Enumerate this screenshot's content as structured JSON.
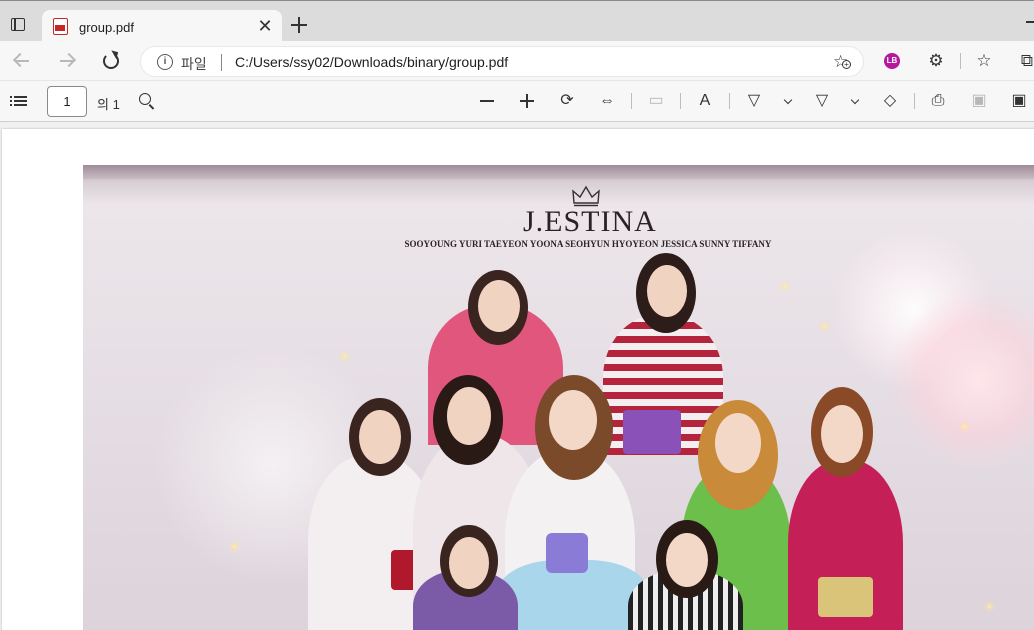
{
  "browser": {
    "tab_title": "group.pdf",
    "tab_close_glyph": "✕",
    "scheme_label": "파일",
    "url": "C:/Users/ssy02/Downloads/binary/group.pdf",
    "profile_initials": "LB"
  },
  "pdf_toolbar": {
    "current_page": "1",
    "page_total": "의 1"
  },
  "document": {
    "brand": "J.ESTINA",
    "member_names": "SOOYOUNG YURI TAEYEON YOONA SEOHYUN HYOYEON JESSICA SUNNY TIFFANY"
  },
  "icons": [
    "window-icon",
    "pdf-file-icon",
    "close-icon",
    "new-tab-icon",
    "back-icon",
    "forward-icon",
    "reload-icon",
    "info-icon",
    "favorite-add-icon",
    "profile-icon",
    "extensions-icon",
    "favorites-icon",
    "collections-icon",
    "table-of-contents-icon",
    "search-icon",
    "zoom-out-icon",
    "zoom-in-icon",
    "rotate-icon",
    "fit-page-icon",
    "page-view-icon",
    "read-aloud-icon",
    "draw-icon",
    "highlight-icon",
    "erase-icon",
    "print-icon",
    "save-icon",
    "save-as-icon"
  ],
  "colors": {
    "pdf_red": "#c62828",
    "profile": "#b5179e"
  }
}
